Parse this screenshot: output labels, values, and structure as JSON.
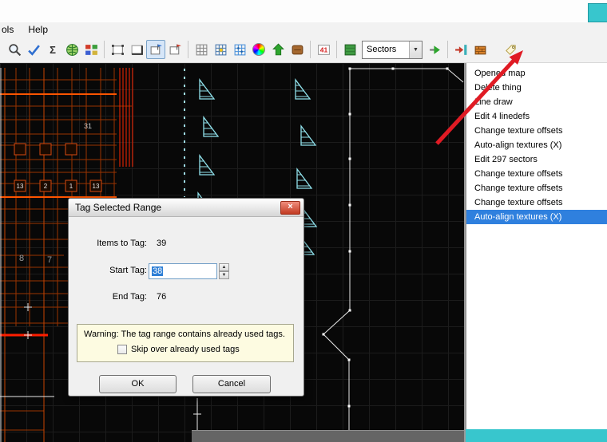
{
  "menu": {
    "items": [
      {
        "label": "ols"
      },
      {
        "label": "Help"
      }
    ]
  },
  "toolbar": {
    "sectors_dropdown": {
      "value": "Sectors"
    },
    "counter_text": "41",
    "icons": [
      "zoom",
      "check",
      "sigma",
      "globe",
      "palette",
      "vertices-mode",
      "linedefs-mode",
      "sectors-mode",
      "things-mode",
      "grid",
      "snap-to-grid",
      "grid-dots",
      "color-wheel",
      "raise-up",
      "brown-tool",
      "selection-numbers",
      "flat",
      "sectors-dropdown",
      "apply",
      "insert",
      "texture-box",
      "tag"
    ]
  },
  "history_panel": {
    "items": [
      {
        "label": "Opened map",
        "selected": false
      },
      {
        "label": "Delete thing",
        "selected": false
      },
      {
        "label": "Line draw",
        "selected": false
      },
      {
        "label": "Edit 4 linedefs",
        "selected": false
      },
      {
        "label": "Change texture offsets",
        "selected": false
      },
      {
        "label": "Auto-align textures (X)",
        "selected": false
      },
      {
        "label": "Edit 297 sectors",
        "selected": false
      },
      {
        "label": "Change texture offsets",
        "selected": false
      },
      {
        "label": "Change texture offsets",
        "selected": false
      },
      {
        "label": "Change texture offsets",
        "selected": false
      },
      {
        "label": "Auto-align textures (X)",
        "selected": true
      }
    ]
  },
  "dialog": {
    "title": "Tag Selected Range",
    "close_label": "×",
    "items_to_tag": {
      "label": "Items to Tag:",
      "value": "39"
    },
    "start_tag": {
      "label": "Start Tag:",
      "value": "38"
    },
    "end_tag": {
      "label": "End Tag:",
      "value": "76"
    },
    "warning": {
      "text": "Warning: The tag range contains already used tags.",
      "checkbox_label": "Skip over already used tags",
      "checked": false
    },
    "buttons": {
      "ok": "OK",
      "cancel": "Cancel"
    }
  },
  "map": {
    "thing_labels": [
      {
        "text": "31"
      },
      {
        "text": "13"
      },
      {
        "text": "2"
      },
      {
        "text": "1"
      },
      {
        "text": "13"
      },
      {
        "text": "8"
      },
      {
        "text": "7"
      }
    ]
  },
  "colors": {
    "selection_blue": "#2e7fd6",
    "panel_selected_blue": "#2f80de",
    "warning_bg": "#fdfbe1",
    "arrow_red": "#e01b24",
    "teal_fragment": "#38c6cd",
    "map_orange": "#c84400",
    "map_cyan": "#8fe0ea"
  }
}
